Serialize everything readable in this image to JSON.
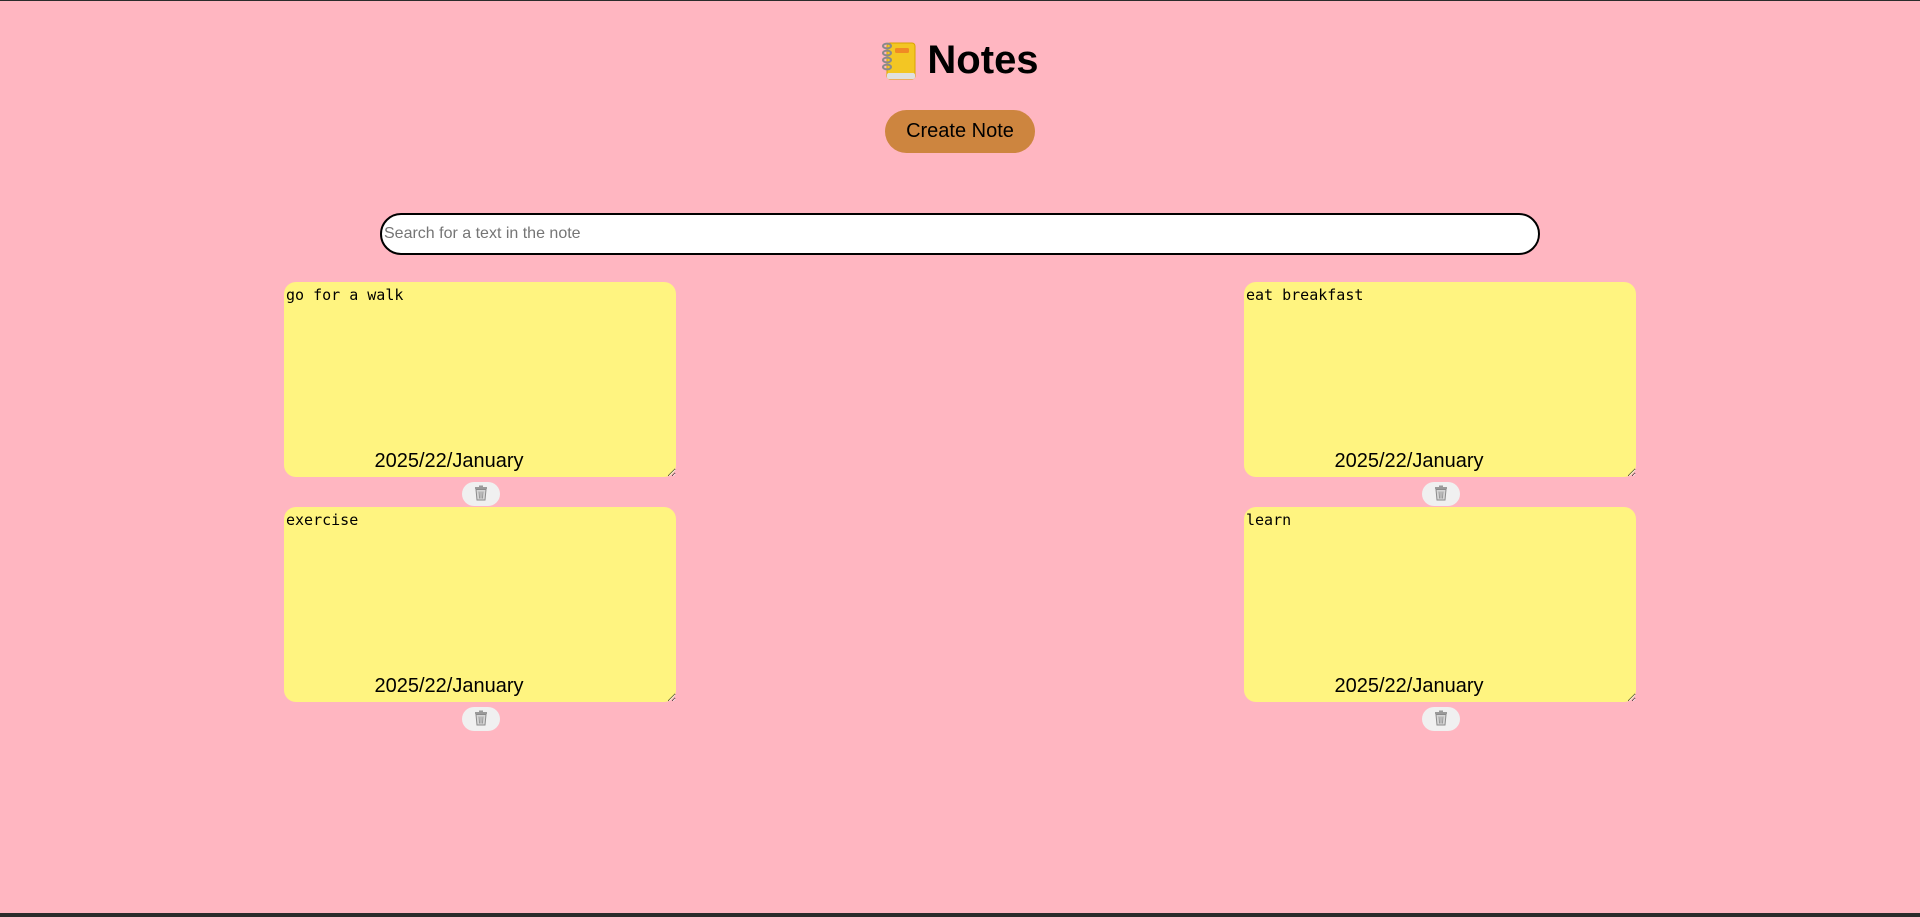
{
  "header": {
    "title": "Notes",
    "icon": "notebook-icon"
  },
  "toolbar": {
    "create_label": "Create Note"
  },
  "search": {
    "placeholder": "Search for a text in the note",
    "value": ""
  },
  "notes": [
    {
      "text": "go for a walk",
      "date": "2025/22/January",
      "delete_icon": "trash-icon"
    },
    {
      "text": "eat breakfast",
      "date": "2025/22/January",
      "delete_icon": "trash-icon"
    },
    {
      "text": "exercise",
      "date": "2025/22/January",
      "delete_icon": "trash-icon"
    },
    {
      "text": "learn",
      "date": "2025/22/January",
      "delete_icon": "trash-icon"
    }
  ],
  "colors": {
    "background": "#ffb6c1",
    "note": "#fff480",
    "button": "#cd853f"
  }
}
